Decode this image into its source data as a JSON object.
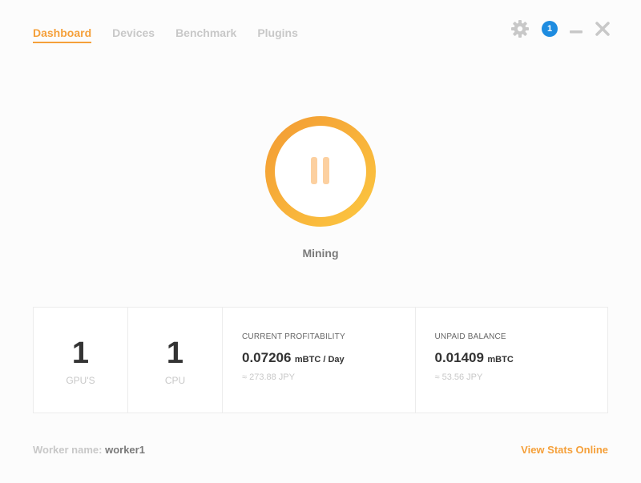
{
  "nav": {
    "tabs": [
      {
        "label": "Dashboard",
        "active": true
      },
      {
        "label": "Devices",
        "active": false
      },
      {
        "label": "Benchmark",
        "active": false
      },
      {
        "label": "Plugins",
        "active": false
      }
    ]
  },
  "window": {
    "notification_count": "1",
    "icons": [
      "gear-icon",
      "notification-badge",
      "minimize-icon",
      "close-icon"
    ]
  },
  "mining": {
    "status": "Mining",
    "state": "running",
    "button_icon": "pause-icon"
  },
  "stats": {
    "gpus": {
      "count": "1",
      "label": "GPU'S"
    },
    "cpus": {
      "count": "1",
      "label": "CPU"
    },
    "profitability": {
      "title": "CURRENT PROFITABILITY",
      "value": "0.07206",
      "unit": "mBTC / Day",
      "fiat": "≈ 273.88 JPY"
    },
    "balance": {
      "title": "UNPAID BALANCE",
      "value": "0.01409",
      "unit": "mBTC",
      "fiat": "≈ 53.56 JPY"
    }
  },
  "footer": {
    "worker_label": "Worker name:",
    "worker_name": "worker1",
    "stats_link": "View Stats Online"
  },
  "colors": {
    "accent": "#f5a03a",
    "ring_start": "#f39c34",
    "ring_end": "#fcc640",
    "pause_icon": "#fcd0a0",
    "badge": "#1e8ce0",
    "muted": "#c8c8c8"
  }
}
